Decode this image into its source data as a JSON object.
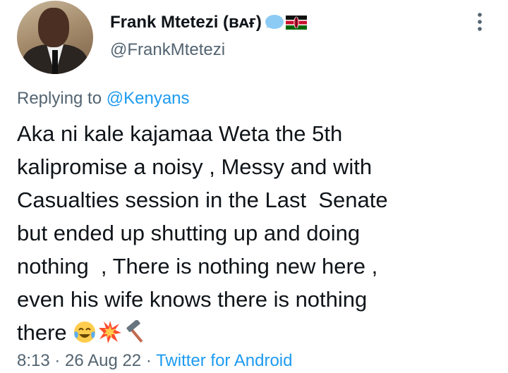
{
  "author": {
    "name": "Frank Mtetezi",
    "badge": "(ʙᴀғ)",
    "handle": "@FrankMtetezi",
    "avatar_icon": "profile-photo"
  },
  "reply": {
    "prefix": "Replying to ",
    "target": "@Kenyans"
  },
  "tweet": {
    "lines": [
      "Aka ni kale kajamaa Weta the 5th",
      "kalipromise a noisy , Messy and with",
      "Casualties session in the Last  Senate",
      "but ended up shutting up and doing",
      "nothing  , There is nothing new here ,",
      "even his wife knows there is nothing",
      "there "
    ],
    "trailing_emojis": [
      "face-with-tears-of-joy",
      "collision",
      "hammer"
    ]
  },
  "meta": {
    "time": "8:13",
    "sep1": " · ",
    "date": "26 Aug 22",
    "sep2": " · ",
    "source": "Twitter for Android"
  },
  "icons": {
    "more": "more-vertical-icon",
    "speech_bubble": "speech-bubble-icon",
    "flag": "kenya-flag-icon"
  },
  "colors": {
    "link": "#1d9bf0",
    "secondary_text": "#536471",
    "primary_text": "#0f1419"
  }
}
